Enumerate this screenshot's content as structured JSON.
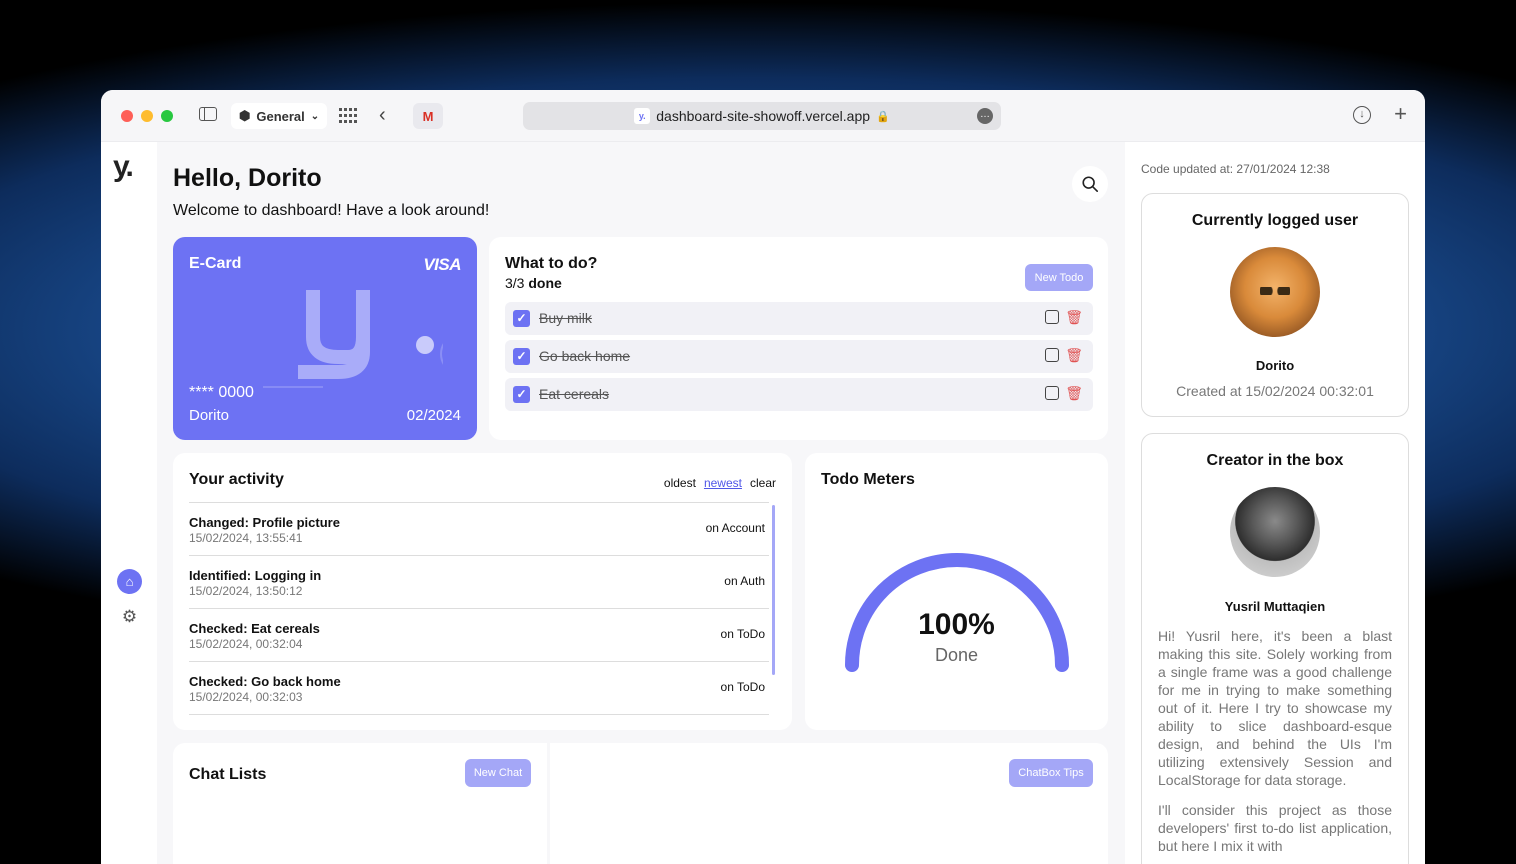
{
  "browser": {
    "profile": "General",
    "url": "dashboard-site-showoff.vercel.app",
    "gmail_tab": "M"
  },
  "nav": {
    "brand": "y."
  },
  "header": {
    "greeting": "Hello, Dorito",
    "welcome": "Welcome to dashboard! Have a look around!"
  },
  "ecard": {
    "title": "E-Card",
    "brand": "VISA",
    "number": "**** 0000",
    "holder": "Dorito",
    "expiry": "02/2024"
  },
  "todos": {
    "title": "What to do?",
    "progress": "3/3",
    "progress_suffix": "done",
    "new_button": "New Todo",
    "items": [
      {
        "label": "Buy milk",
        "done": true
      },
      {
        "label": "Go back home",
        "done": true
      },
      {
        "label": "Eat cereals",
        "done": true
      }
    ]
  },
  "activity": {
    "title": "Your activity",
    "sort": {
      "oldest": "oldest",
      "newest": "newest",
      "clear": "clear"
    },
    "items": [
      {
        "name": "Changed: Profile picture",
        "time": "15/02/2024, 13:55:41",
        "where": "on Account"
      },
      {
        "name": "Identified: Logging in",
        "time": "15/02/2024, 13:50:12",
        "where": "on Auth"
      },
      {
        "name": "Checked: Eat cereals",
        "time": "15/02/2024, 00:32:04",
        "where": "on ToDo"
      },
      {
        "name": "Checked: Go back home",
        "time": "15/02/2024, 00:32:03",
        "where": "on ToDo"
      }
    ]
  },
  "meters": {
    "title": "Todo Meters",
    "value": "100%",
    "label": "Done",
    "fraction": 1.0
  },
  "chat": {
    "title": "Chat Lists",
    "new_button": "New Chat",
    "tips_button": "ChatBox Tips"
  },
  "right": {
    "updated": "Code updated at: 27/01/2024 12:38",
    "user_card": {
      "title": "Currently logged user",
      "name": "Dorito",
      "created": "Created at 15/02/2024 00:32:01"
    },
    "creator_card": {
      "title": "Creator in the box",
      "name": "Yusril Muttaqien",
      "bio_1": "Hi! Yusril here, it's been a blast making this site. Solely working from a single frame was a good challenge for me in trying to make something out of it. Here I try to showcase my ability to slice dashboard-esque design, and behind the UIs I'm utilizing extensively Session and LocalStorage for data storage.",
      "bio_2": "I'll consider this project as those developers' first to-do list application, but here I mix it with"
    }
  },
  "colors": {
    "accent": "#6d72f3",
    "accent_light": "#a4a7f7",
    "danger": "#e05252"
  }
}
